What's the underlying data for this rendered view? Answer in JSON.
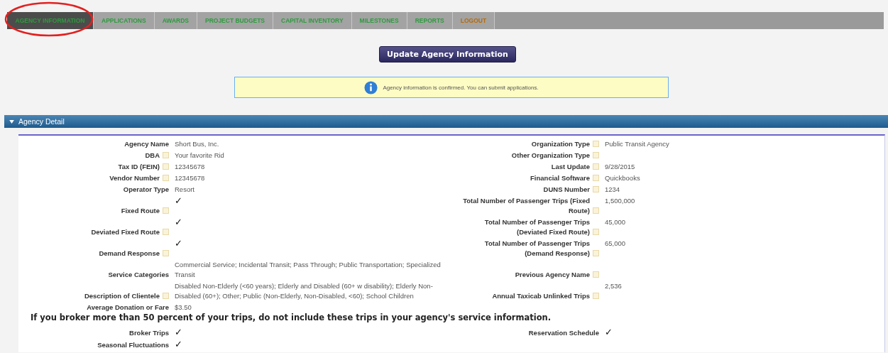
{
  "tabs": [
    {
      "label": "AGENCY INFORMATION",
      "selected": true,
      "kind": "normal"
    },
    {
      "label": "APPLICATIONS",
      "selected": false,
      "kind": "normal"
    },
    {
      "label": "AWARDS",
      "selected": false,
      "kind": "normal"
    },
    {
      "label": "PROJECT BUDGETS",
      "selected": false,
      "kind": "normal"
    },
    {
      "label": "CAPITAL INVENTORY",
      "selected": false,
      "kind": "normal"
    },
    {
      "label": "MILESTONES",
      "selected": false,
      "kind": "normal"
    },
    {
      "label": "REPORTS",
      "selected": false,
      "kind": "normal"
    },
    {
      "label": "LOGOUT",
      "selected": false,
      "kind": "logout"
    }
  ],
  "annotation": {
    "kind": "ellipse",
    "color": "#e32020"
  },
  "update_button": "Update Agency Information",
  "info_message": "Agency information is confirmed. You can submit applications.",
  "section": {
    "title": "Agency Detail",
    "expanded": true
  },
  "detail_rows": [
    {
      "left": {
        "label": "Agency Name",
        "help": false,
        "kind": "text",
        "value": "Short Bus, Inc."
      },
      "right": {
        "label": "Organization Type",
        "help": true,
        "kind": "text",
        "value": "Public Transit Agency"
      }
    },
    {
      "left": {
        "label": "DBA",
        "help": true,
        "kind": "text",
        "value": "Your favorite Rid"
      },
      "right": {
        "label": "Other Organization Type",
        "help": true,
        "kind": "text"
      }
    },
    {
      "left": {
        "label": "Tax ID (FEIN)",
        "help": true,
        "kind": "text",
        "value": "12345678"
      },
      "right": {
        "label": "Last Update",
        "help": true,
        "kind": "text",
        "value": "9/28/2015"
      }
    },
    {
      "left": {
        "label": "Vendor Number",
        "help": true,
        "kind": "text",
        "value": "12345678"
      },
      "right": {
        "label": "Financial Software",
        "help": true,
        "kind": "text",
        "value": "Quickbooks"
      }
    },
    {
      "left": {
        "label": "Operator Type",
        "help": false,
        "kind": "text",
        "value": "Resort"
      },
      "right": {
        "label": "DUNS Number",
        "help": true,
        "kind": "text",
        "value": "1234"
      }
    },
    {
      "left": {
        "label": "Fixed Route",
        "help": true,
        "kind": "check",
        "value": "✓"
      },
      "right": {
        "label": "Total Number of Passenger Trips (Fixed Route)",
        "help": true,
        "kind": "text",
        "value": "1,500,000"
      }
    },
    {
      "left": {
        "label": "Deviated Fixed Route",
        "help": true,
        "kind": "check",
        "value": "✓"
      },
      "right": {
        "label": "Total Number of Passenger Trips (Deviated Fixed Route)",
        "help": true,
        "kind": "text",
        "value": "45,000"
      }
    },
    {
      "left": {
        "label": "Demand Response",
        "help": true,
        "kind": "check",
        "value": "✓"
      },
      "right": {
        "label": "Total Number of Passenger Trips (Demand Response)",
        "help": true,
        "kind": "text",
        "value": "65,000"
      }
    },
    {
      "left": {
        "label": "Service Categories",
        "help": false,
        "kind": "text",
        "value": "Commercial Service; Incidental Transit; Pass Through; Public Transportation; Specialized Transit"
      },
      "right": {
        "label": "Previous Agency Name",
        "help": true,
        "kind": "text"
      }
    },
    {
      "left": {
        "label": "Description of Clientele",
        "help": true,
        "kind": "text",
        "value": "Disabled Non-Elderly (<60 years); Elderly and Disabled (60+ w disability); Elderly Non-Disabled (60+); Other; Public (Non-Elderly, Non-Disabled, <60); School Children"
      },
      "right": {
        "label": "Annual Taxicab Unlinked Trips",
        "help": true,
        "kind": "text",
        "value": "2,536"
      }
    },
    {
      "left": {
        "label": "Average Donation or Fare",
        "help": false,
        "kind": "text",
        "value": "$3.50"
      }
    }
  ],
  "broker_notice": "If you broker more than 50 percent of your trips, do not include these trips in your agency's service information.",
  "broker_rows": [
    {
      "left": {
        "label": "Broker Trips",
        "help": false,
        "kind": "check",
        "value": "✓"
      },
      "right": {
        "label": "Reservation Schedule",
        "help": false,
        "kind": "check",
        "value": "✓"
      }
    },
    {
      "left": {
        "label": "Seasonal Fluctuations",
        "help": false,
        "kind": "check",
        "value": "✓"
      }
    }
  ]
}
